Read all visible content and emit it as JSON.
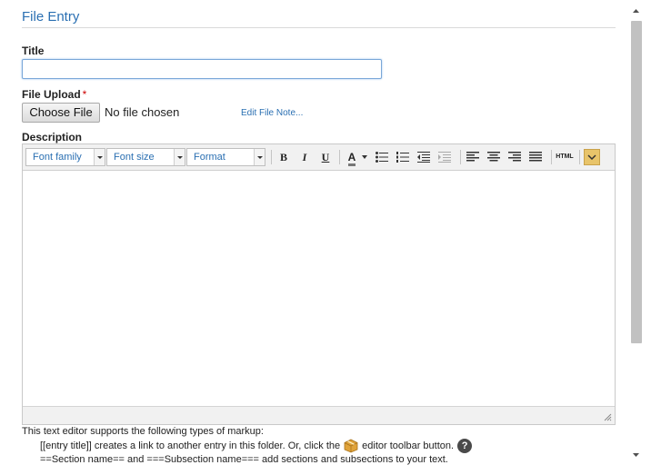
{
  "page": {
    "heading": "File Entry"
  },
  "form": {
    "title_label": "Title",
    "title_value": "",
    "upload_label": "File Upload",
    "required_marker": "*",
    "choose_file_label": "Choose File",
    "no_file_text": "No file chosen",
    "edit_file_note": "Edit File Note...",
    "description_label": "Description"
  },
  "toolbar": {
    "font_family": "Font family",
    "font_size": "Font size",
    "format": "Format",
    "bold": "B",
    "italic": "I",
    "underline": "U",
    "font_color": "A",
    "html": "HTML"
  },
  "help": {
    "intro": "This text editor supports the following types of markup:",
    "line1_before": "[[entry title]] creates a link to another entry in this folder. Or, click the",
    "line1_after": "editor toolbar button.",
    "help_glyph": "?",
    "line2": "==Section name== and ===Subsection name=== add sections and subsections to your text."
  },
  "colors": {
    "accent": "#2a6fb2",
    "required": "#cc0000"
  }
}
